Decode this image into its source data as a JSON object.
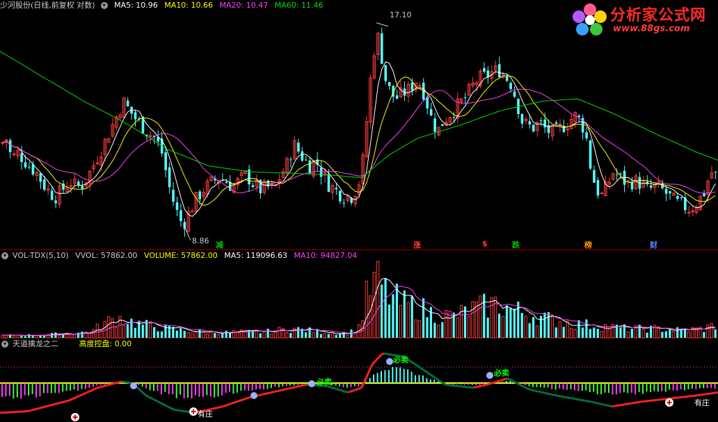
{
  "colors": {
    "up": "#ff3c3c",
    "down": "#54ffff",
    "ma5": "#ffffff",
    "ma10": "#ffff00",
    "ma20": "#ff40ff",
    "ma60": "#00e000",
    "signal_red": "#ff2020",
    "signal_green": "#007040",
    "signal_yellow": "#ffff00"
  },
  "main_panel": {
    "title": "少河股份(日线,前复权 对数)",
    "indicators": [
      {
        "label": "MA5: 10.96",
        "color": "#ffffff"
      },
      {
        "label": "MA10: 10.66",
        "color": "#ffff00"
      },
      {
        "label": "MA20: 10.47",
        "color": "#ff40ff"
      },
      {
        "label": "MA60: 11.46",
        "color": "#00e000"
      }
    ],
    "high_label": "17.10",
    "low_label": "8.86",
    "event_tags": [
      {
        "text": "减",
        "color": "#00c000"
      },
      {
        "text": "涨",
        "color": "#ff3c3c"
      },
      {
        "text": "$",
        "color": "#ff3c3c"
      },
      {
        "text": "跌",
        "color": "#00c000"
      },
      {
        "text": "榜",
        "color": "#ff9a00"
      },
      {
        "text": "财",
        "color": "#4a8cff"
      }
    ]
  },
  "logo": {
    "text": "分析家公式网",
    "url_text": "www.88gs.com"
  },
  "vol_panel": {
    "title": "VOL-TDX(5,10)",
    "indicators": [
      {
        "label": "VVOL: 57862.00",
        "color": "#cccccc"
      },
      {
        "label": "VOLUME: 57862.00",
        "color": "#ffff00"
      },
      {
        "label": "MA5: 119096.63",
        "color": "#ffffff"
      },
      {
        "label": "MA10: 94827.04",
        "color": "#ff40ff"
      }
    ]
  },
  "ind_panel": {
    "title": "天道擒龙之二",
    "indicator_label": "高度控盘: 0.00",
    "signals": [
      {
        "text": "必卖",
        "color": "#00ff00"
      },
      {
        "text": "必卖",
        "color": "#00ff00"
      },
      {
        "text": "必卖",
        "color": "#00ff00"
      },
      {
        "text": "有庄",
        "color": "#ffffff"
      },
      {
        "text": "有庄",
        "color": "#ffffff"
      }
    ]
  },
  "chart_data": {
    "type": "line",
    "note_scale": "log",
    "ylim": [
      8.5,
      17.6
    ],
    "price_anchors": [
      [
        0,
        11.6
      ],
      [
        8,
        11.8
      ],
      [
        15,
        11.0
      ],
      [
        22,
        11.3
      ],
      [
        30,
        11.1
      ],
      [
        40,
        10.8
      ],
      [
        50,
        10.6
      ],
      [
        60,
        10.2
      ],
      [
        70,
        9.9
      ],
      [
        78,
        9.8
      ],
      [
        88,
        10.0
      ],
      [
        98,
        10.3
      ],
      [
        108,
        10.1
      ],
      [
        118,
        10.2
      ],
      [
        128,
        10.6
      ],
      [
        138,
        11.1
      ],
      [
        148,
        11.6
      ],
      [
        158,
        12.2
      ],
      [
        168,
        12.8
      ],
      [
        175,
        13.3
      ],
      [
        182,
        13.0
      ],
      [
        192,
        12.6
      ],
      [
        202,
        12.3
      ],
      [
        212,
        12.0
      ],
      [
        222,
        11.8
      ],
      [
        232,
        11.2
      ],
      [
        240,
        10.2
      ],
      [
        248,
        9.6
      ],
      [
        256,
        9.1
      ],
      [
        262,
        8.95
      ],
      [
        270,
        9.3
      ],
      [
        280,
        9.7
      ],
      [
        290,
        10.0
      ],
      [
        300,
        10.2
      ],
      [
        312,
        10.4
      ],
      [
        322,
        10.3
      ],
      [
        332,
        10.1
      ],
      [
        342,
        10.3
      ],
      [
        352,
        10.5
      ],
      [
        362,
        10.2
      ],
      [
        372,
        10.0
      ],
      [
        382,
        10.1
      ],
      [
        392,
        10.0
      ],
      [
        402,
        10.5
      ],
      [
        412,
        10.9
      ],
      [
        420,
        11.6
      ],
      [
        428,
        11.3
      ],
      [
        436,
        11.0
      ],
      [
        444,
        10.8
      ],
      [
        452,
        11.0
      ],
      [
        460,
        10.6
      ],
      [
        470,
        10.2
      ],
      [
        480,
        10.0
      ],
      [
        492,
        9.8
      ],
      [
        505,
        9.8
      ],
      [
        515,
        10.3
      ],
      [
        522,
        11.3
      ],
      [
        528,
        13.5
      ],
      [
        534,
        15.2
      ],
      [
        540,
        16.6
      ],
      [
        546,
        15.5
      ],
      [
        552,
        14.3
      ],
      [
        558,
        13.8
      ],
      [
        566,
        13.4
      ],
      [
        576,
        13.6
      ],
      [
        586,
        13.8
      ],
      [
        596,
        14.2
      ],
      [
        604,
        14.0
      ],
      [
        612,
        13.2
      ],
      [
        620,
        12.4
      ],
      [
        628,
        12.1
      ],
      [
        636,
        12.5
      ],
      [
        646,
        12.8
      ],
      [
        656,
        13.1
      ],
      [
        666,
        13.4
      ],
      [
        676,
        13.9
      ],
      [
        686,
        14.3
      ],
      [
        696,
        14.4
      ],
      [
        706,
        14.6
      ],
      [
        716,
        14.7
      ],
      [
        724,
        14.4
      ],
      [
        732,
        14.1
      ],
      [
        740,
        13.4
      ],
      [
        748,
        12.5
      ],
      [
        756,
        12.3
      ],
      [
        764,
        12.2
      ],
      [
        774,
        12.4
      ],
      [
        784,
        12.1
      ],
      [
        794,
        12.0
      ],
      [
        804,
        12.2
      ],
      [
        814,
        12.4
      ],
      [
        824,
        12.7
      ],
      [
        832,
        12.5
      ],
      [
        840,
        12.0
      ],
      [
        848,
        10.6
      ],
      [
        856,
        10.0
      ],
      [
        864,
        9.8
      ],
      [
        872,
        10.2
      ],
      [
        880,
        10.6
      ],
      [
        890,
        10.4
      ],
      [
        900,
        10.2
      ],
      [
        910,
        10.3
      ],
      [
        920,
        10.2
      ],
      [
        930,
        10.0
      ],
      [
        940,
        10.1
      ],
      [
        950,
        10.0
      ],
      [
        960,
        9.8
      ],
      [
        970,
        9.6
      ],
      [
        980,
        9.5
      ],
      [
        990,
        9.4
      ],
      [
        1000,
        9.6
      ],
      [
        1010,
        9.9
      ],
      [
        1020,
        10.6
      ],
      [
        1030,
        10.4
      ]
    ],
    "ma60_anchors": [
      [
        0,
        15.6
      ],
      [
        60,
        14.4
      ],
      [
        120,
        13.3
      ],
      [
        180,
        12.4
      ],
      [
        240,
        11.4
      ],
      [
        300,
        10.8
      ],
      [
        360,
        10.6
      ],
      [
        420,
        10.55
      ],
      [
        470,
        10.5
      ],
      [
        520,
        10.4
      ],
      [
        560,
        11.2
      ],
      [
        600,
        11.8
      ],
      [
        660,
        12.3
      ],
      [
        720,
        12.9
      ],
      [
        780,
        13.3
      ],
      [
        830,
        13.4
      ],
      [
        880,
        12.8
      ],
      [
        940,
        12.0
      ],
      [
        1000,
        11.3
      ],
      [
        1032,
        11.0
      ]
    ],
    "vol_anchors": [
      [
        0,
        0.03
      ],
      [
        60,
        0.04
      ],
      [
        130,
        0.08
      ],
      [
        150,
        0.2
      ],
      [
        170,
        0.26
      ],
      [
        200,
        0.18
      ],
      [
        240,
        0.12
      ],
      [
        280,
        0.08
      ],
      [
        320,
        0.07
      ],
      [
        380,
        0.08
      ],
      [
        420,
        0.12
      ],
      [
        460,
        0.08
      ],
      [
        500,
        0.06
      ],
      [
        516,
        0.16
      ],
      [
        526,
        0.55
      ],
      [
        540,
        0.78
      ],
      [
        552,
        0.6
      ],
      [
        575,
        0.45
      ],
      [
        600,
        0.4
      ],
      [
        625,
        0.3
      ],
      [
        650,
        0.28
      ],
      [
        680,
        0.38
      ],
      [
        710,
        0.44
      ],
      [
        740,
        0.36
      ],
      [
        770,
        0.28
      ],
      [
        800,
        0.22
      ],
      [
        830,
        0.18
      ],
      [
        860,
        0.16
      ],
      [
        900,
        0.12
      ],
      [
        940,
        0.12
      ],
      [
        980,
        0.1
      ],
      [
        1010,
        0.12
      ],
      [
        1032,
        0.18
      ]
    ],
    "osc_anchors": [
      [
        0,
        0.95
      ],
      [
        40,
        0.9
      ],
      [
        100,
        0.55
      ],
      [
        140,
        0.15
      ],
      [
        175,
        -0.05
      ],
      [
        190,
        0.0
      ],
      [
        210,
        0.4
      ],
      [
        250,
        0.85
      ],
      [
        280,
        0.95
      ],
      [
        320,
        0.75
      ],
      [
        360,
        0.45
      ],
      [
        400,
        0.25
      ],
      [
        440,
        0.05
      ],
      [
        470,
        0.1
      ],
      [
        500,
        0.3
      ],
      [
        520,
        0.15
      ],
      [
        535,
        -0.6
      ],
      [
        550,
        -0.95
      ],
      [
        580,
        -0.85
      ],
      [
        610,
        -0.4
      ],
      [
        640,
        0.05
      ],
      [
        680,
        0.15
      ],
      [
        700,
        0.05
      ],
      [
        730,
        -0.15
      ],
      [
        760,
        0.2
      ],
      [
        800,
        0.4
      ],
      [
        850,
        0.6
      ],
      [
        880,
        0.75
      ],
      [
        920,
        0.6
      ],
      [
        960,
        0.5
      ],
      [
        1000,
        0.4
      ],
      [
        1032,
        0.3
      ]
    ]
  }
}
